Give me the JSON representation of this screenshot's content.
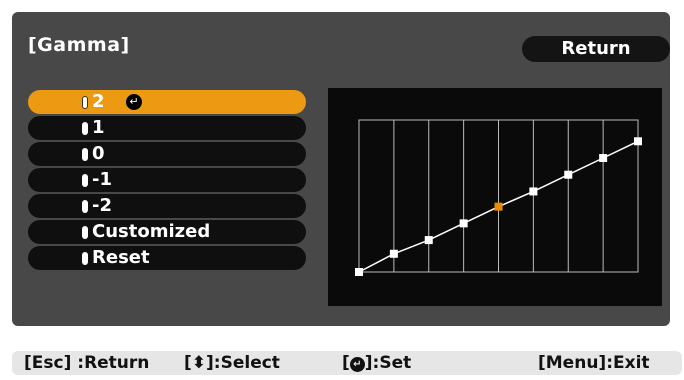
{
  "panel": {
    "title": "[Gamma]",
    "return_label": "Return",
    "enter_glyph": "↵"
  },
  "menu": {
    "items": [
      {
        "label": "2",
        "selected": true
      },
      {
        "label": "1"
      },
      {
        "label": "0"
      },
      {
        "label": "-1"
      },
      {
        "label": "-2"
      },
      {
        "label": "Customized"
      },
      {
        "label": "Reset"
      }
    ]
  },
  "status_bar": {
    "esc": "[Esc] :Return",
    "select_prefix": "[",
    "select_glyph": "⬍",
    "select_suffix": "]:Select",
    "set_prefix": "[",
    "set_glyph": "↵",
    "set_suffix": "]:Set",
    "menu": "[Menu]:Exit"
  },
  "chart_data": {
    "type": "line",
    "x": [
      0,
      1,
      2,
      3,
      4,
      5,
      6,
      7,
      8
    ],
    "series": [
      {
        "values": [
          0,
          12,
          21,
          32,
          43,
          53,
          64,
          75,
          86
        ]
      }
    ],
    "highlight_index": 4,
    "colors": {
      "line": "#ffffff",
      "point": "#ffffff",
      "highlight": "#ec8a00",
      "grid": "#bbbbbb"
    },
    "ylim": [
      0,
      100
    ]
  },
  "colors": {
    "accent": "#ec9a12",
    "panel_bg": "#484848",
    "item_bg": "#0f0f0f"
  }
}
